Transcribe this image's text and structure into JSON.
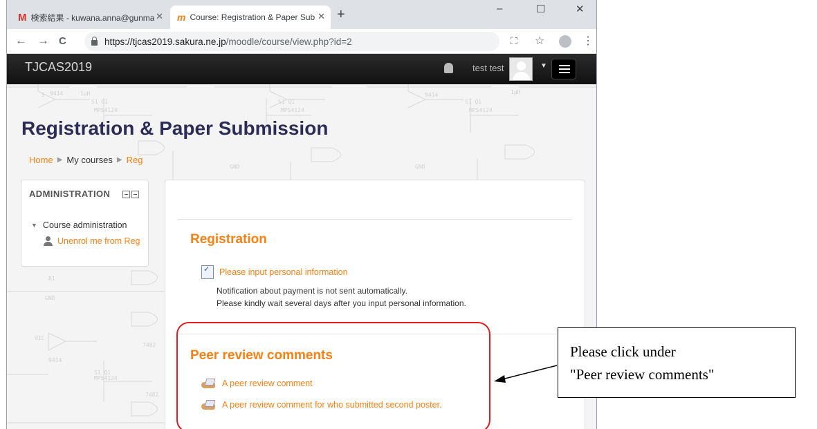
{
  "browser": {
    "tabs": [
      {
        "title": "検索結果 - kuwana.anna@gunma",
        "close": "✕",
        "icon": "gmail-icon"
      },
      {
        "title": "Course: Registration & Paper Sub",
        "close": "✕",
        "icon": "moodle-icon"
      }
    ],
    "new_tab": "+",
    "window_controls": {
      "minimize": "–",
      "maximize": "☐",
      "close": "✕"
    },
    "nav": {
      "back": "←",
      "forward": "→",
      "reload": "C"
    },
    "url_host": "https://tjcas2019.sakura.ne.jp",
    "url_path": "/moodle/course/view.php?id=2",
    "toolbar_icons": {
      "translate": "⛶",
      "star": "☆",
      "menu": "⋮"
    }
  },
  "navbar": {
    "site_name": "TJCAS2019",
    "user_name": "test test",
    "caret": "▼"
  },
  "page": {
    "title": "Registration & Paper Submission",
    "breadcrumb": [
      {
        "label": "Home"
      },
      {
        "label": "My courses"
      },
      {
        "label": "Reg"
      }
    ],
    "breadcrumb_sep": "▶"
  },
  "admin_block": {
    "title": "ADMINISTRATION",
    "course_admin": "Course administration",
    "unenrol": "Unenrol me from Reg",
    "toggle": "▼"
  },
  "sections": {
    "registration": {
      "title": "Registration",
      "activity": "Please input personal information",
      "notice_1": "Notification about payment is not sent automatically.",
      "notice_2": "Please kindly wait several days after you input personal information."
    },
    "peer_review": {
      "title": "Peer review comments",
      "activity_1": "A peer review comment",
      "activity_2": "A peer review comment for who submitted second poster."
    }
  },
  "annotation": {
    "line_1": "Please click under",
    "line_2": "\"Peer review comments\"",
    "highlight_color": "#e31a1a"
  },
  "colors": {
    "accent": "#f98012",
    "title": "#2b2d57",
    "navbar": "#1a1a1a"
  }
}
